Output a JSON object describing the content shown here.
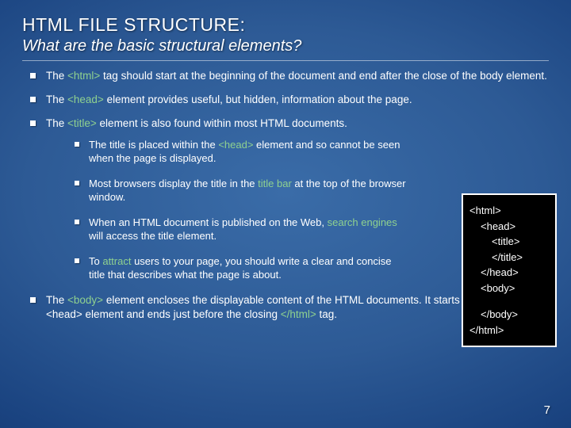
{
  "title": "HTML FILE STRUCTURE:",
  "subtitle": "What are the basic structural elements?",
  "bullets": {
    "b1_pre": "The ",
    "b1_hl": "<html>",
    "b1_post": " tag should start at the beginning of the document and end after the close of the body element.",
    "b2_pre": "The ",
    "b2_hl": "<head>",
    "b2_post": " element provides useful, but hidden, information about the page.",
    "b3_pre": "The ",
    "b3_hl": "<title>",
    "b3_post": " element is also found within most HTML documents.",
    "b4_pre": "The ",
    "b4_hl": "<body>",
    "b4_post": " element encloses the displayable content of the HTML documents.  It starts at the end of the <head> element and ends just before the closing ",
    "b4_hl2": "</html>",
    "b4_post2": " tag."
  },
  "sub": {
    "s1_pre": "The title is placed within the ",
    "s1_hl": "<head>",
    "s1_post": " element and so cannot be seen when the page is displayed.",
    "s2_pre": "Most browsers display the title in the ",
    "s2_hl": "title bar",
    "s2_post": " at the top of the browser window.",
    "s3_pre": "When an HTML document is published on the Web, ",
    "s3_hl": "search engines",
    "s3_post": " will access the title element.",
    "s4_pre": "To ",
    "s4_hl": "attract",
    "s4_post": " users to your page, you should write a clear and concise title that describes what the page is about."
  },
  "code": {
    "l1": "<html>",
    "l2": "<head>",
    "l3": "<title></title>",
    "l4": "</head>",
    "l5": "<body>",
    "l6": "</body>",
    "l7": "</html>"
  },
  "page_number": "7"
}
